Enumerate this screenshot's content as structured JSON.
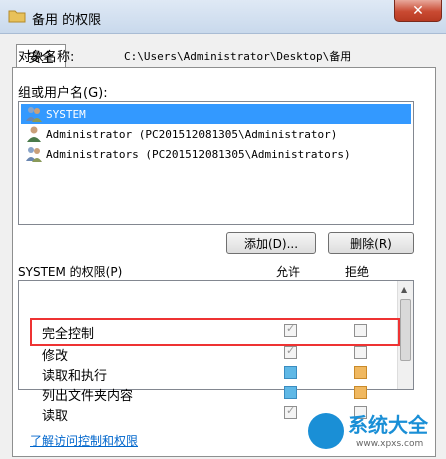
{
  "window": {
    "title": "备用 的权限",
    "close_glyph": "✕"
  },
  "tabs": [
    {
      "label": "安全"
    }
  ],
  "object": {
    "label": "对象名称:",
    "value": "C:\\Users\\Administrator\\Desktop\\备用"
  },
  "group": {
    "label": "组或用户名(G):",
    "users": [
      {
        "name": "SYSTEM",
        "selected": true,
        "icon": "user-group-icon"
      },
      {
        "name": "Administrator (PC201512081305\\Administrator)",
        "selected": false,
        "icon": "user-icon"
      },
      {
        "name": "Administrators (PC201512081305\\Administrators)",
        "selected": false,
        "icon": "user-group-icon"
      }
    ]
  },
  "buttons": {
    "add": "添加(D)...",
    "remove": "删除(R)"
  },
  "permissions": {
    "label": "SYSTEM 的权限(P)",
    "allow_header": "允许",
    "deny_header": "拒绝",
    "rows": [
      {
        "name": "完全控制",
        "allow": "checked",
        "deny": "unchecked"
      },
      {
        "name": "修改",
        "allow": "checked",
        "deny": "unchecked"
      },
      {
        "name": "读取和执行",
        "allow": "blue",
        "deny": "orange"
      },
      {
        "name": "列出文件夹内容",
        "allow": "blue",
        "deny": "orange"
      },
      {
        "name": "读取",
        "allow": "checked",
        "deny": "unchecked"
      }
    ]
  },
  "link": {
    "text": "了解访问控制和权限"
  },
  "watermark": {
    "text": "系统大全",
    "url": "www.xpxs.com"
  },
  "colors": {
    "selection": "#3399ff",
    "highlight_box": "#ee3333",
    "link": "#0066cc",
    "watermark": "#1a8fd6"
  }
}
